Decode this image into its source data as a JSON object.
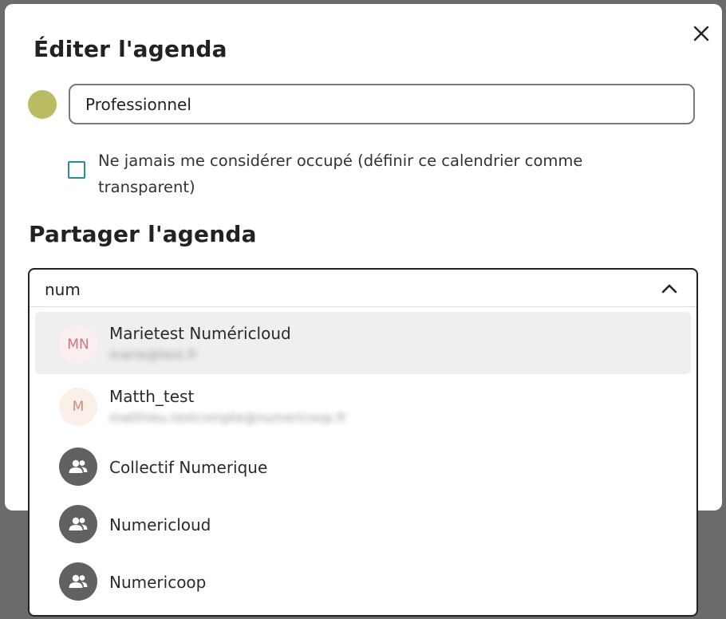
{
  "edit_section": {
    "title": "Éditer l'agenda",
    "calendar_name": "Professionnel",
    "calendar_color": "#b9bc63",
    "transparent_checkbox_label": "Ne jamais me considérer occupé (définir ce calendrier comme transparent)",
    "transparent_checked": false
  },
  "share_section": {
    "title": "Partager l'agenda",
    "search_value": "num",
    "results": [
      {
        "type": "user",
        "initials": "MN",
        "name": "Marietest Numéricloud",
        "subtitle": "marie@test.fr",
        "highlighted": true
      },
      {
        "type": "user",
        "initials": "M",
        "name": "Matth_test",
        "subtitle": "matthieu.testcompte@numericoop.fr",
        "highlighted": false
      },
      {
        "type": "group",
        "icon": "group-icon",
        "name": "Collectif Numerique"
      },
      {
        "type": "group",
        "icon": "group-icon",
        "name": "Numericloud"
      },
      {
        "type": "group",
        "icon": "group-icon",
        "name": "Numericoop"
      }
    ]
  },
  "icons": {
    "close": "close-icon",
    "dropdown_toggle": "chevron-up-icon"
  }
}
